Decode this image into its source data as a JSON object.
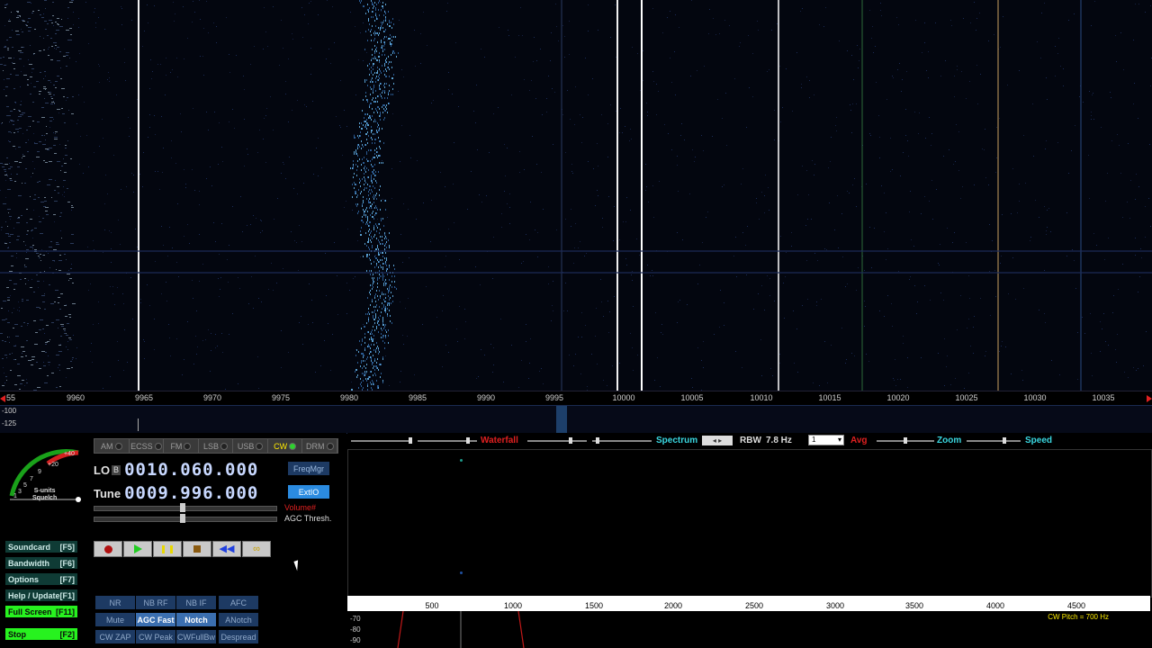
{
  "waterfall": {
    "freq_ticks": [
      "55",
      "9960",
      "9965",
      "9970",
      "9975",
      "9980",
      "9985",
      "9990",
      "9995",
      "10000",
      "10005",
      "10010",
      "10015",
      "10020",
      "10025",
      "10030",
      "10035"
    ],
    "db_labels": [
      "-100",
      "-125"
    ]
  },
  "modes": [
    {
      "label": "AM",
      "active": false
    },
    {
      "label": "ECSS",
      "active": false
    },
    {
      "label": "FM",
      "active": false
    },
    {
      "label": "LSB",
      "active": false
    },
    {
      "label": "USB",
      "active": false
    },
    {
      "label": "CW",
      "active": true
    },
    {
      "label": "DRM",
      "active": false
    }
  ],
  "smeter": {
    "scale": [
      "+40",
      "+20",
      "9",
      "7",
      "5",
      "3",
      "1"
    ],
    "label_line1": "S-units",
    "label_line2": "Squelch"
  },
  "lo": {
    "label": "LO",
    "b_label": "B",
    "value": "0010.060.000"
  },
  "tune": {
    "label": "Tune",
    "value": "0009.996.000"
  },
  "side_buttons": {
    "freqmgr": "FreqMgr",
    "extio": "ExtIO"
  },
  "sliders": {
    "volume_label": "Volume#",
    "agc_label": "AGC Thresh."
  },
  "left_buttons": [
    {
      "label": "Soundcard",
      "key": "[F5]",
      "style": "teal"
    },
    {
      "label": "Bandwidth",
      "key": "[F6]",
      "style": "teal"
    },
    {
      "label": "Options",
      "key": "[F7]",
      "style": "teal"
    },
    {
      "label": "Help / Update",
      "key": "[F1]",
      "style": "teal"
    },
    {
      "label": "Full Screen",
      "key": "[F11]",
      "style": "green"
    },
    {
      "label": "Stop",
      "key": "[F2]",
      "style": "green"
    }
  ],
  "dsp_buttons": [
    [
      {
        "label": "NR",
        "on": false
      },
      {
        "label": "NB RF",
        "on": false
      },
      {
        "label": "NB IF",
        "on": false
      },
      {
        "label": "AFC",
        "on": false
      }
    ],
    [
      {
        "label": "Mute",
        "on": false
      },
      {
        "label": "AGC Fast",
        "on": true
      },
      {
        "label": "Notch",
        "on": true
      },
      {
        "label": "ANotch",
        "on": false
      }
    ],
    [
      {
        "label": "CW ZAP",
        "on": false
      },
      {
        "label": "CW Peak",
        "on": false
      },
      {
        "label": "CWFullBw",
        "on": false
      },
      {
        "label": "Despread",
        "on": false
      }
    ]
  ],
  "audio_toolbar": {
    "waterfall": "Waterfall",
    "spectrum": "Spectrum",
    "rbw_label": "RBW",
    "rbw_value": "7.8 Hz",
    "avg_select": "1",
    "avg": "Avg",
    "zoom": "Zoom",
    "speed": "Speed"
  },
  "audio_ruler": [
    "500",
    "1000",
    "1500",
    "2000",
    "2500",
    "3000",
    "3500",
    "4000",
    "4500"
  ],
  "audio_db": [
    "-70",
    "-80",
    "-90"
  ],
  "cw_pitch": "CW Pitch = 700 Hz",
  "colors": {
    "accent_cyan": "#3ad7e0",
    "accent_red": "#e02020",
    "green_btn": "#27f21f",
    "teal_btn": "#0f3b35"
  }
}
